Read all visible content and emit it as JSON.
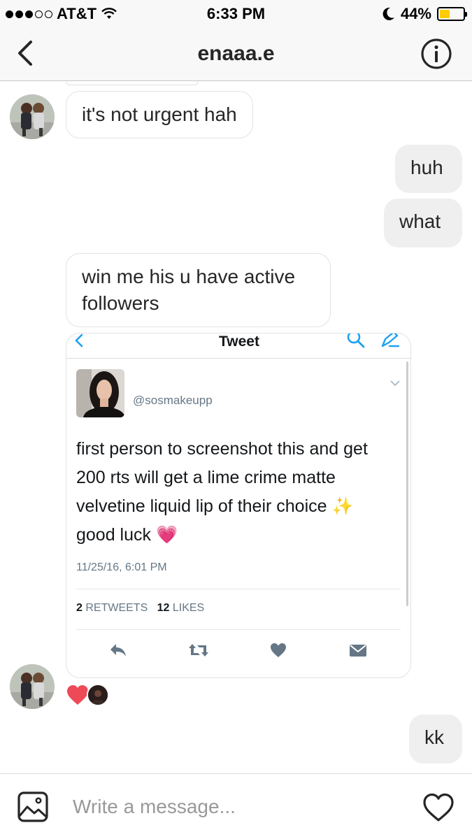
{
  "status_bar": {
    "carrier": "AT&T",
    "time": "6:33 PM",
    "battery": "44%",
    "battery_level": 0.44,
    "icons": [
      "signal-dots-icon",
      "wifi-icon",
      "moon-icon",
      "battery-icon"
    ]
  },
  "header": {
    "title": "enaaa.e",
    "back_icon": "chevron-left-icon",
    "info_icon": "info-icon"
  },
  "messages": [
    {
      "side": "in",
      "text": "it's not  urgent hah"
    },
    {
      "side": "out",
      "text": "huh"
    },
    {
      "side": "out",
      "text": "what"
    },
    {
      "side": "in",
      "text": "win me his u have active followers"
    },
    {
      "side": "out",
      "text": "kk"
    }
  ],
  "shared_tweet": {
    "header_title": "Tweet",
    "handle": "@sosmakeupp",
    "text_lines": [
      "first person to screenshot this and get",
      "200 rts will get a lime crime matte",
      "velvetine liquid lip of their choice ✨",
      "good luck 💗"
    ],
    "date": "11/25/16, 6:01 PM",
    "retweets_count": "2",
    "retweets_label": "RETWEETS",
    "likes_count": "12",
    "likes_label": "LIKES",
    "actions": [
      "reply-icon",
      "retweet-icon",
      "like-icon",
      "dm-icon"
    ]
  },
  "reactions": [
    "heart-reaction-icon",
    "reactor-avatar"
  ],
  "input_bar": {
    "placeholder": "Write a message...",
    "left_icon": "photo-icon",
    "right_icon": "heart-icon"
  },
  "colors": {
    "accent_blue": "#1da1f2",
    "twitter_gray": "#657786",
    "heart_red": "#ed4956",
    "bubble_out": "#efefef",
    "battery_yellow": "#ffcc00"
  }
}
